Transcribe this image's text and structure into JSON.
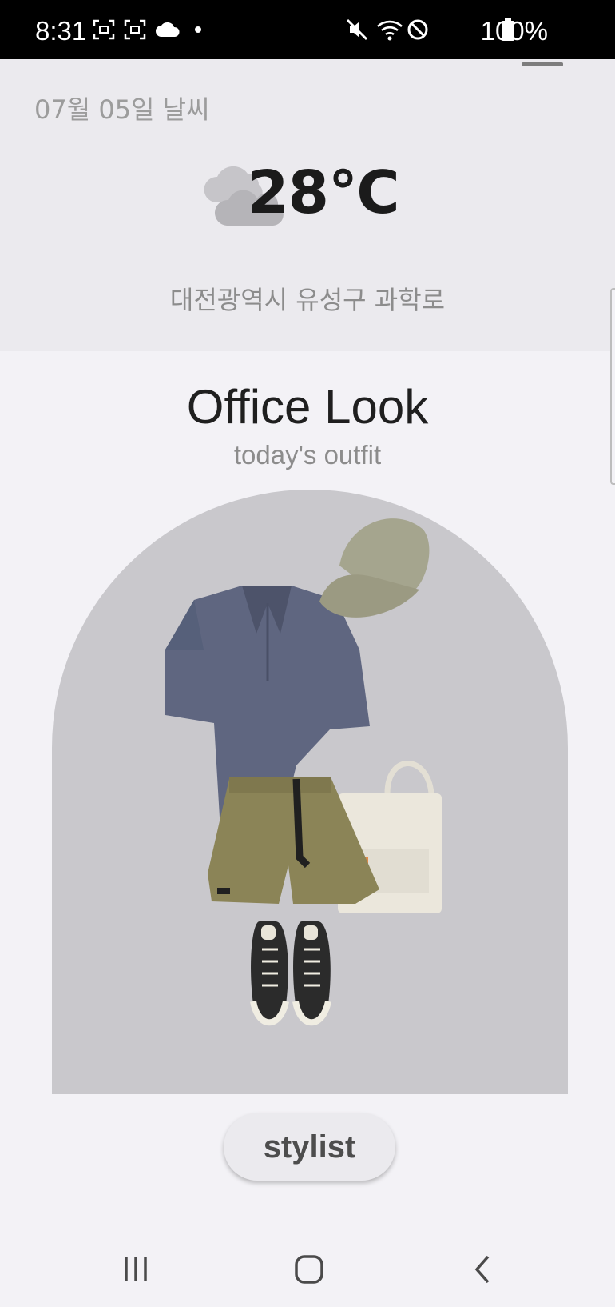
{
  "status_bar": {
    "time": "8:31",
    "battery": "100%",
    "icons": [
      "screenshot-icon",
      "screen-record-icon",
      "cloud-icon",
      "dot-icon",
      "mute-icon",
      "wifi-icon",
      "blocked-icon",
      "battery-icon"
    ]
  },
  "weather": {
    "date": "07월 05일 날씨",
    "temperature": "28℃",
    "condition_icon": "cloud-icon",
    "location": "대전광역시 유성구 과학로"
  },
  "outfit": {
    "title": "Office Look",
    "subtitle": "today's outfit",
    "items": [
      "polo-shirt",
      "cap",
      "tote-bag",
      "shorts",
      "sneakers"
    ],
    "colors": {
      "arch_background": "#c9c8cc",
      "shirt": "#5f6680",
      "cap": "#a5a58e",
      "shorts": "#8b8457",
      "bag": "#ebe7dc",
      "sneakers": "#2b2b2b"
    }
  },
  "actions": {
    "stylist_label": "stylist"
  },
  "nav": {
    "recent": "recent-apps-icon",
    "home": "home-icon",
    "back": "back-icon"
  }
}
